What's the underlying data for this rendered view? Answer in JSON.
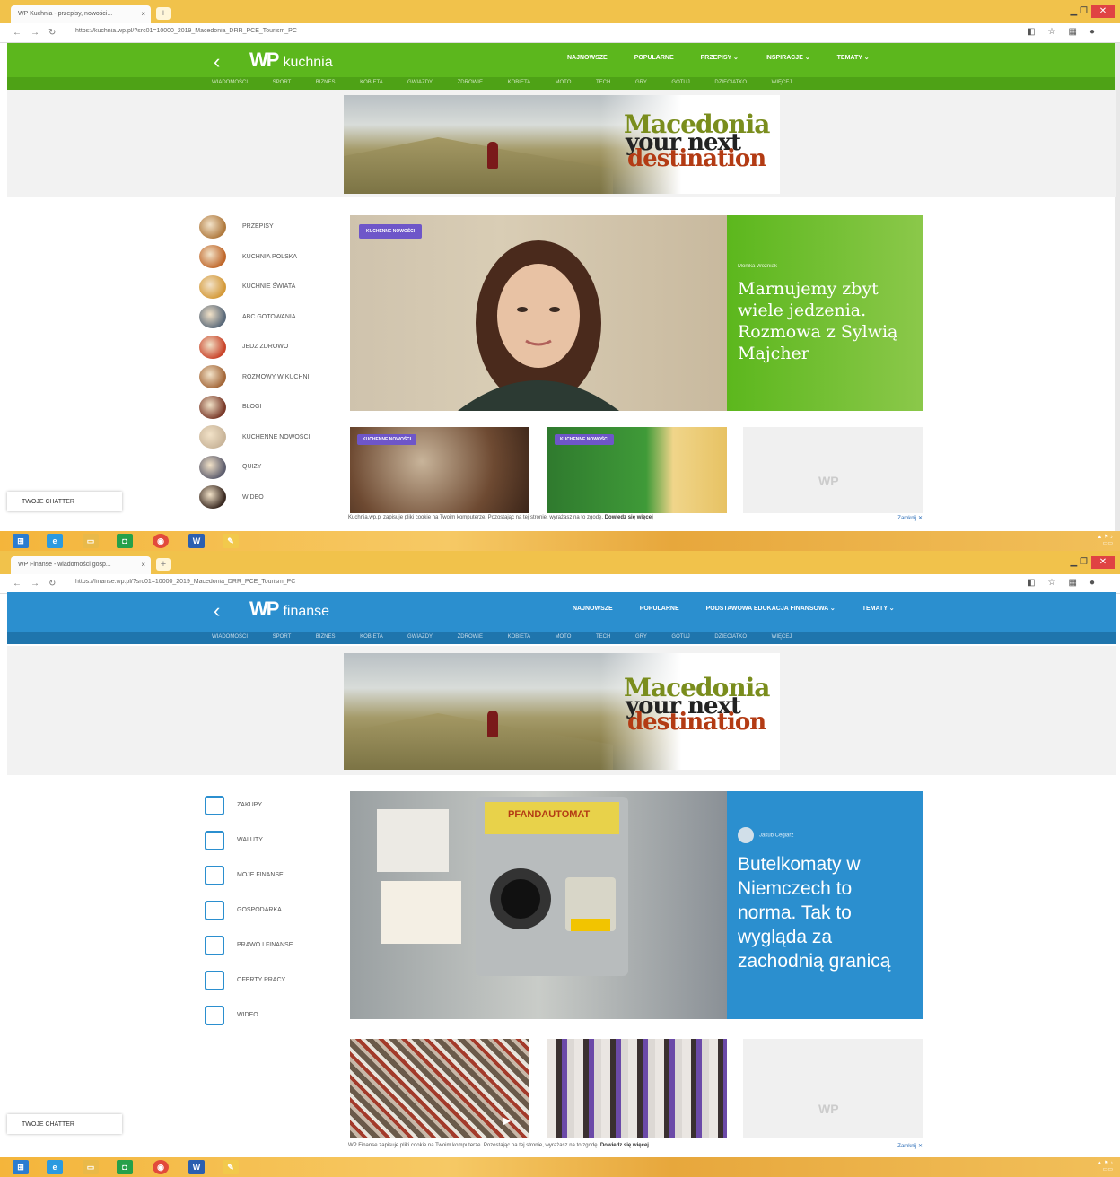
{
  "shot1": {
    "tab_title": "WP Kuchnia - przepisy, nowości...",
    "url": "https://kuchnia.wp.pl/?src01=10000_2019_Macedonia_DRR_PCE_Tourism_PC",
    "site": {
      "brand": "WP",
      "section": "kuchnia",
      "back": "‹"
    },
    "mainnav": [
      "NAJNOWSZE",
      "POPULARNE",
      "PRZEPISY ⌄",
      "INSPIRACJE ⌄",
      "TEMATY ⌄"
    ],
    "subnav": [
      "WIADOMOŚCI",
      "SPORT",
      "BIZNES",
      "KOBIETA",
      "GWIAZDY",
      "ZDROWIE",
      "KOBIETA",
      "MOTO",
      "TECH",
      "GRY",
      "GOTUJ",
      "DZIECIATKO",
      "WIĘCEJ"
    ],
    "banner": {
      "line1": "Macedonia",
      "line2": "your next",
      "line3": "destination"
    },
    "sidebar": [
      {
        "label": "PRZEPISY",
        "color": "#b07a3f"
      },
      {
        "label": "KUCHNIA POLSKA",
        "color": "#c0682c"
      },
      {
        "label": "KUCHNIE ŚWIATA",
        "color": "#d49a3a"
      },
      {
        "label": "ABC GOTOWANIA",
        "color": "#5b6a7a"
      },
      {
        "label": "JEDZ ZDROWO",
        "color": "#c9442a"
      },
      {
        "label": "ROZMOWY W KUCHNI",
        "color": "#a4683a"
      },
      {
        "label": "BLOGI",
        "color": "#7a3a2a"
      },
      {
        "label": "KUCHENNE NOWOŚCI",
        "color": "#c9b59a"
      },
      {
        "label": "QUIZY",
        "color": "#5e5e6e"
      },
      {
        "label": "WIDEO",
        "color": "#3a2a22"
      }
    ],
    "hero": {
      "badge": "KUCHENNE NOWOŚCI",
      "author": "Monika Woźniak",
      "headline": "Marnujemy zbyt wiele jedzenia. Rozmowa z Sylwią Majcher"
    },
    "cards": [
      {
        "badge": "KUCHENNE NOWOŚCI"
      },
      {
        "badge": "KUCHENNE NOWOŚCI"
      }
    ],
    "ad_logo": "WP",
    "cookie": {
      "text": "Kuchnia.wp.pl zapisuje pliki cookie na Twoim komputerze. Pozostając na tej stronie, wyrażasz na to zgodę.",
      "more": "Dowiedz się więcej",
      "dismiss": "Zamknij ✕"
    },
    "floating": "TWOJE CHATTER"
  },
  "shot2": {
    "tab_title": "WP Finanse - wiadomości gosp...",
    "url": "https://finanse.wp.pl/?src01=10000_2019_Macedonia_DRR_PCE_Tourism_PC",
    "site": {
      "brand": "WP",
      "section": "finanse",
      "back": "‹"
    },
    "mainnav": [
      "NAJNOWSZE",
      "POPULARNE",
      "PODSTAWOWA EDUKACJA FINANSOWA ⌄",
      "TEMATY ⌄"
    ],
    "subnav": [
      "WIADOMOŚCI",
      "SPORT",
      "BIZNES",
      "KOBIETA",
      "GWIAZDY",
      "ZDROWIE",
      "KOBIETA",
      "MOTO",
      "TECH",
      "GRY",
      "GOTUJ",
      "DZIECIATKO",
      "WIĘCEJ"
    ],
    "banner": {
      "line1": "Macedonia",
      "line2": "your next",
      "line3": "destination"
    },
    "sidebar": [
      {
        "label": "ZAKUPY"
      },
      {
        "label": "WALUTY"
      },
      {
        "label": "MOJE FINANSE"
      },
      {
        "label": "GOSPODARKA"
      },
      {
        "label": "PRAWO I FINANSE"
      },
      {
        "label": "OFERTY PRACY"
      },
      {
        "label": "WIDEO"
      }
    ],
    "hero": {
      "author": "Jakub Ceglarz",
      "headline": "Butelkomaty w Niemczech to norma. Tak to wygląda za zachodnią granicą",
      "machine_label": "PFANDAUTOMAT"
    },
    "ad_logo": "WP",
    "cookie": {
      "text": "WP Finanse zapisuje pliki cookie na Twoim komputerze. Pozostając na tej stronie, wyrażasz na to zgodę.",
      "more": "Dowiedz się więcej",
      "dismiss": "Zamknij ✕"
    },
    "floating": "TWOJE CHATTER"
  },
  "taskbar": {
    "apps": [
      "start",
      "internet-explorer",
      "file-explorer",
      "store",
      "chrome",
      "word",
      "paint"
    ]
  }
}
